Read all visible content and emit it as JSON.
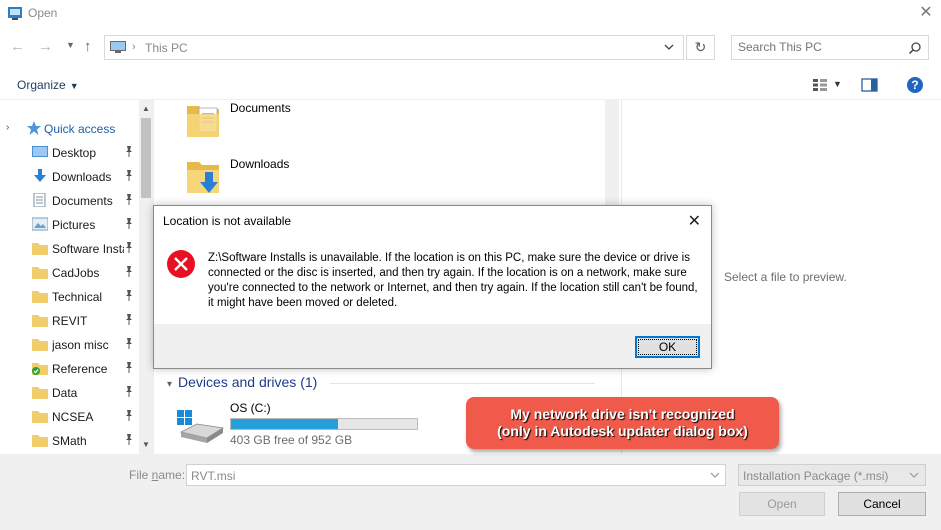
{
  "window": {
    "title": "Open"
  },
  "navigation": {
    "address_path": "This PC",
    "search_placeholder": "Search This PC"
  },
  "toolbar": {
    "organize_label": "Organize"
  },
  "sidebar": {
    "quick_access_label": "Quick access",
    "items": [
      {
        "label": "Desktop",
        "icon": "desktop-icon"
      },
      {
        "label": "Downloads",
        "icon": "download-arrow-icon"
      },
      {
        "label": "Documents",
        "icon": "documents-icon"
      },
      {
        "label": "Pictures",
        "icon": "pictures-icon"
      },
      {
        "label": "Software Installs",
        "icon": "folder-icon"
      },
      {
        "label": "CadJobs",
        "icon": "folder-icon"
      },
      {
        "label": "Technical",
        "icon": "folder-icon"
      },
      {
        "label": "REVIT",
        "icon": "folder-icon"
      },
      {
        "label": "jason misc",
        "icon": "folder-icon"
      },
      {
        "label": "Reference",
        "icon": "folder-synced-icon"
      },
      {
        "label": "Data",
        "icon": "folder-icon"
      },
      {
        "label": "NCSEA",
        "icon": "folder-icon"
      },
      {
        "label": "SMath",
        "icon": "folder-icon"
      }
    ]
  },
  "content": {
    "folders": [
      {
        "name": "Documents",
        "icon": "documents-folder-icon"
      },
      {
        "name": "Downloads",
        "icon": "downloads-folder-icon"
      }
    ],
    "devices_header": "Devices and drives (1)",
    "drive": {
      "name": "OS (C:)",
      "free_text": "403 GB free of 952 GB",
      "used_fraction": 0.577
    }
  },
  "preview": {
    "message": "Select a file to preview."
  },
  "footer": {
    "file_name_label_pre": "File ",
    "file_name_label_u": "n",
    "file_name_label_post": "ame:",
    "file_name_value": "RVT.msi",
    "file_type_value": "Installation Package (*.msi)",
    "open_label": "Open",
    "cancel_label": "Cancel"
  },
  "dialog": {
    "title": "Location is not available",
    "message": "Z:\\Software Installs is unavailable. If the location is on this PC, make sure the device or drive is connected or the disc is inserted, and then try again. If the location is on a network, make sure you're connected to the network or Internet, and then try again. If the location still can't be found, it might have been moved or deleted.",
    "ok_label": "OK"
  },
  "annotation": {
    "line1": "My network drive isn't recognized",
    "line2": "(only in Autodesk updater dialog box)"
  },
  "colors": {
    "accent": "#0078d7",
    "error": "#e81123",
    "callout": "#f05a4a",
    "progress": "#26a0da"
  }
}
